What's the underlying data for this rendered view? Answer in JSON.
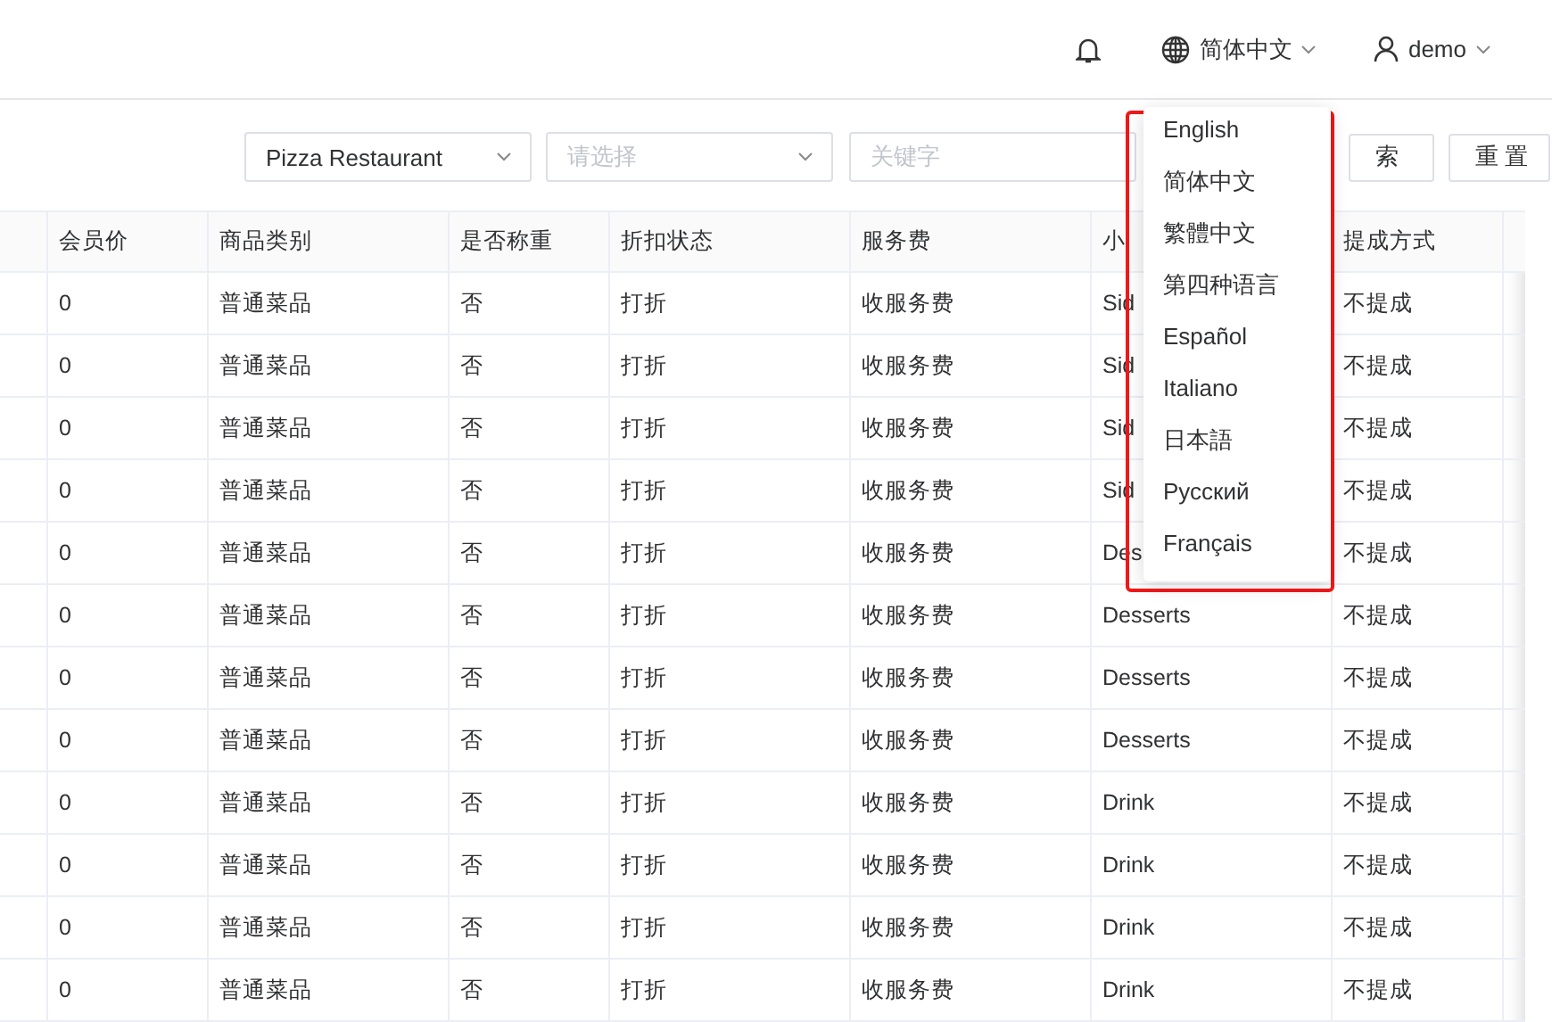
{
  "header": {
    "language": "简体中文",
    "user": "demo"
  },
  "filters": {
    "store": {
      "value": "Pizza Restaurant"
    },
    "category": {
      "placeholder": "请选择"
    },
    "keyword": {
      "placeholder": "关键字"
    },
    "buttons": [
      "索",
      "重 置"
    ]
  },
  "table": {
    "columns": [
      "会员价",
      "商品类别",
      "是否称重",
      "折扣状态",
      "服务费",
      "小",
      "提成方式"
    ],
    "rows": [
      [
        "0",
        "普通菜品",
        "否",
        "打折",
        "收服务费",
        "Sid",
        "不提成"
      ],
      [
        "0",
        "普通菜品",
        "否",
        "打折",
        "收服务费",
        "Sid",
        "不提成"
      ],
      [
        "0",
        "普通菜品",
        "否",
        "打折",
        "收服务费",
        "Sid",
        "不提成"
      ],
      [
        "0",
        "普通菜品",
        "否",
        "打折",
        "收服务费",
        "Sid",
        "不提成"
      ],
      [
        "0",
        "普通菜品",
        "否",
        "打折",
        "收服务费",
        "Des",
        "不提成"
      ],
      [
        "0",
        "普通菜品",
        "否",
        "打折",
        "收服务费",
        "Desserts",
        "不提成"
      ],
      [
        "0",
        "普通菜品",
        "否",
        "打折",
        "收服务费",
        "Desserts",
        "不提成"
      ],
      [
        "0",
        "普通菜品",
        "否",
        "打折",
        "收服务费",
        "Desserts",
        "不提成"
      ],
      [
        "0",
        "普通菜品",
        "否",
        "打折",
        "收服务费",
        "Drink",
        "不提成"
      ],
      [
        "0",
        "普通菜品",
        "否",
        "打折",
        "收服务费",
        "Drink",
        "不提成"
      ],
      [
        "0",
        "普通菜品",
        "否",
        "打折",
        "收服务费",
        "Drink",
        "不提成"
      ],
      [
        "0",
        "普通菜品",
        "否",
        "打折",
        "收服务费",
        "Drink",
        "不提成"
      ]
    ]
  },
  "language_menu": {
    "items": [
      "English",
      "简体中文",
      "繁體中文",
      "第四种语言",
      "Español",
      "Italiano",
      "日本語",
      "Русский",
      "Français"
    ]
  }
}
